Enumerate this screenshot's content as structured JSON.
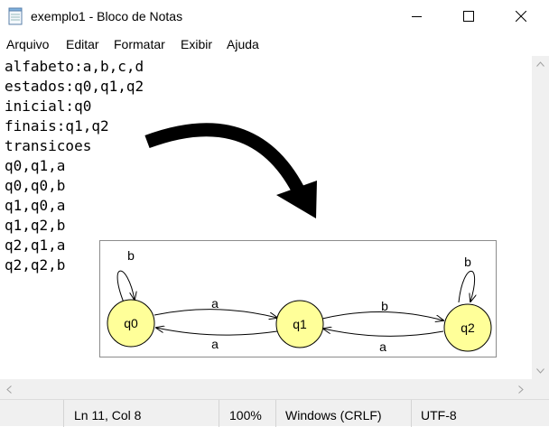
{
  "window": {
    "title": "exemplo1 - Bloco de Notas",
    "icon": "notepad-icon"
  },
  "menu": [
    "Arquivo",
    "Editar",
    "Formatar",
    "Exibir",
    "Ajuda"
  ],
  "editor": {
    "lines": [
      "alfabeto:a,b,c,d",
      "estados:q0,q1,q2",
      "inicial:q0",
      "finais:q1,q2",
      "transicoes",
      "q0,q1,a",
      "q0,q0,b",
      "q1,q0,a",
      "q1,q2,b",
      "q2,q1,a",
      "q2,q2,b"
    ]
  },
  "diagram": {
    "states": [
      "q0",
      "q1",
      "q2"
    ],
    "transitions": [
      {
        "from": "q0",
        "to": "q0",
        "label": "b"
      },
      {
        "from": "q0",
        "to": "q1",
        "label": "a"
      },
      {
        "from": "q1",
        "to": "q0",
        "label": "a"
      },
      {
        "from": "q1",
        "to": "q2",
        "label": "b"
      },
      {
        "from": "q2",
        "to": "q1",
        "label": "a"
      },
      {
        "from": "q2",
        "to": "q2",
        "label": "b"
      }
    ],
    "state_fill": "#ffff99"
  },
  "status": {
    "position": "Ln 11, Col 8",
    "zoom": "100%",
    "line_ending": "Windows (CRLF)",
    "encoding": "UTF-8"
  }
}
